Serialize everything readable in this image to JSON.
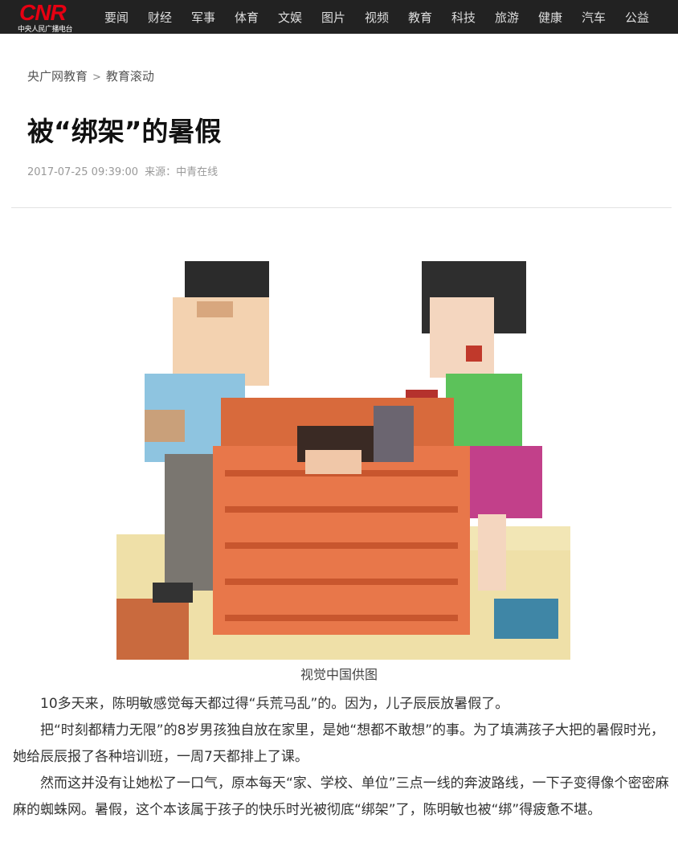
{
  "header": {
    "logo_text": "CNR",
    "logo_subtitle": "中央人民广播电台",
    "nav": [
      "要闻",
      "财经",
      "军事",
      "体育",
      "文娱",
      "图片",
      "视频",
      "教育",
      "科技",
      "旅游",
      "健康",
      "汽车",
      "公益"
    ]
  },
  "breadcrumb": {
    "first": "央广网教育",
    "separator": ">",
    "second": "教育滚动"
  },
  "article": {
    "title": "被“绑架”的暑假",
    "datetime": "2017-07-25 09:39:00",
    "source": "来源：中青在线",
    "image_caption": "视觉中国供图",
    "paragraphs": [
      "10多天来，陈明敏感觉每天都过得“兵荒马乱”的。因为，儿子辰辰放暑假了。",
      "把“时刻都精力无限”的8岁男孩独自放在家里，是她“想都不敢想”的事。为了填满孩子大把的暑假时光，她给辰辰报了各种培训班，一周7天都排上了课。",
      "然而这并没有让她松了一口气，原本每天“家、学校、单位”三点一线的奔波路线，一下子变得像个密密麻麻的蜘蛛网。暑假，这个本该属于孩子的快乐时光被彻底“绑架”了，陈明敏也被“绑”得疲惫不堪。"
    ]
  },
  "colors": {
    "topbar": "#222222",
    "logo_red": "#e60012",
    "brick": "#e8774a",
    "shirt_blue": "#8ec4e0",
    "dress_pink": "#c2408a",
    "top_green": "#5cc25a"
  }
}
